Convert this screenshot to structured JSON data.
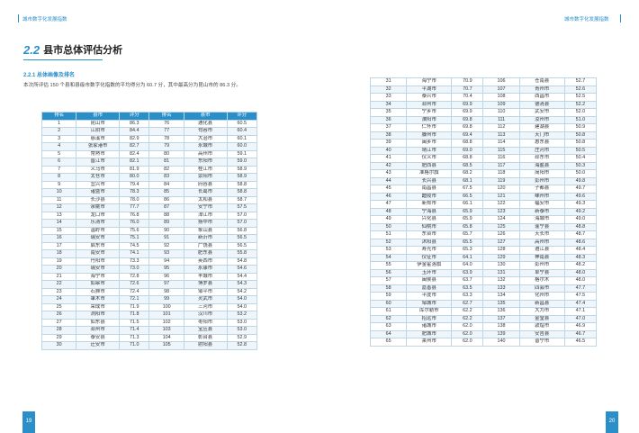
{
  "header": {
    "left_title": "城市数字化发展指数",
    "right_title": "城市数字化发展指数"
  },
  "section": {
    "number": "2.2",
    "title": "县市总体评估分析"
  },
  "subsection": {
    "title": "2.2.1 总体画像及排名"
  },
  "paragraph": "本次所评估 150 个县和县级市数字化指数的平均得分为 60.7 分，其中最高分为昆山市的 86.3 分。",
  "table_headers": [
    "排名",
    "县市",
    "评分",
    "排名",
    "县市",
    "评分"
  ],
  "left_rows": [
    [
      "1",
      "昆山市",
      "86.3",
      "76",
      "通化县",
      "60.5"
    ],
    [
      "2",
      "江阴市",
      "84.4",
      "77",
      "句容市",
      "60.4"
    ],
    [
      "3",
      "慈溪市",
      "82.9",
      "78",
      "大治市",
      "60.1"
    ],
    [
      "4",
      "张家港市",
      "82.7",
      "79",
      "永城市",
      "60.0"
    ],
    [
      "5",
      "常熟市",
      "82.4",
      "80",
      "高州市",
      "59.1"
    ],
    [
      "6",
      "晋江市",
      "82.1",
      "81",
      "东阳市",
      "59.0"
    ],
    [
      "7",
      "义乌市",
      "81.9",
      "82",
      "桂江市",
      "58.9"
    ],
    [
      "8",
      "太仓市",
      "80.0",
      "83",
      "荥阳市",
      "58.9"
    ],
    [
      "9",
      "宜兴市",
      "79.4",
      "84",
      "府谷县",
      "58.8"
    ],
    [
      "10",
      "诸暨市",
      "78.3",
      "85",
      "长葛市",
      "58.8"
    ],
    [
      "11",
      "长沙县",
      "78.0",
      "86",
      "太和县",
      "58.7"
    ],
    [
      "12",
      "余姚市",
      "77.7",
      "87",
      "安宁市",
      "57.5"
    ],
    [
      "13",
      "龙口市",
      "76.8",
      "88",
      "漳江市",
      "57.0"
    ],
    [
      "14",
      "乐清市",
      "76.0",
      "89",
      "扬中市",
      "57.0"
    ],
    [
      "15",
      "温岭市",
      "75.6",
      "90",
      "象山县",
      "56.8"
    ],
    [
      "16",
      "瑞安市",
      "75.1",
      "91",
      "新沂市",
      "56.5"
    ],
    [
      "17",
      "启东市",
      "74.5",
      "92",
      "广饶县",
      "56.5"
    ],
    [
      "18",
      "南安市",
      "74.1",
      "93",
      "肥东县",
      "55.8"
    ],
    [
      "19",
      "丹阳市",
      "73.3",
      "94",
      "英西市",
      "54.8"
    ],
    [
      "20",
      "瑞安市",
      "73.0",
      "95",
      "永康市",
      "54.6"
    ],
    [
      "21",
      "海宁市",
      "72.8",
      "96",
      "丰城市",
      "54.4"
    ],
    [
      "22",
      "如皋市",
      "72.6",
      "97",
      "博罗县",
      "54.3"
    ],
    [
      "23",
      "石狮市",
      "72.4",
      "98",
      "邹平市",
      "54.2"
    ],
    [
      "24",
      "肇木市",
      "72.1",
      "99",
      "灵武市",
      "54.0"
    ],
    [
      "25",
      "荣成市",
      "71.9",
      "100",
      "三河市",
      "54.0"
    ],
    [
      "26",
      "浏阳市",
      "71.8",
      "101",
      "汉川市",
      "53.2"
    ],
    [
      "27",
      "如东县",
      "71.5",
      "102",
      "枣阳市",
      "53.0"
    ],
    [
      "28",
      "邳州市",
      "71.4",
      "103",
      "宝应县",
      "53.0"
    ],
    [
      "29",
      "泰安县",
      "71.3",
      "104",
      "彰台县",
      "52.9"
    ],
    [
      "30",
      "迁安市",
      "71.0",
      "105",
      "射阳县",
      "52.8"
    ]
  ],
  "right_rows": [
    [
      "31",
      "海宁市",
      "70.9",
      "106",
      "苍南县",
      "52.7"
    ],
    [
      "32",
      "平湖市",
      "70.7",
      "107",
      "青州市",
      "52.6"
    ],
    [
      "33",
      "泰兴市",
      "70.4",
      "108",
      "西昌市",
      "52.5"
    ],
    [
      "34",
      "邳州市",
      "69.9",
      "109",
      "德清县",
      "52.2"
    ],
    [
      "35",
      "宁乡市",
      "69.9",
      "110",
      "武安市",
      "52.0"
    ],
    [
      "36",
      "溧阳市",
      "69.8",
      "111",
      "汝州市",
      "51.0"
    ],
    [
      "37",
      "仁怀市",
      "69.8",
      "112",
      "建湖县",
      "50.9"
    ],
    [
      "38",
      "滕州市",
      "69.4",
      "113",
      "天门市",
      "50.8"
    ],
    [
      "39",
      "闽乡市",
      "68.8",
      "114",
      "惠东县",
      "50.8"
    ],
    [
      "40",
      "靖江市",
      "69.0",
      "115",
      "庄河市",
      "50.5"
    ],
    [
      "41",
      "仪义市",
      "68.8",
      "116",
      "邳东市",
      "50.4"
    ],
    [
      "42",
      "肥西县",
      "68.5",
      "117",
      "海盐县",
      "50.3"
    ],
    [
      "43",
      "准格尔旗",
      "68.2",
      "118",
      "简阳市",
      "50.0"
    ],
    [
      "44",
      "长兴县",
      "68.1",
      "119",
      "彭州市",
      "49.8"
    ],
    [
      "45",
      "南昌县",
      "67.5",
      "120",
      "子都县",
      "49.7"
    ],
    [
      "46",
      "醴陵市",
      "66.5",
      "121",
      "嵊州市",
      "49.6"
    ],
    [
      "47",
      "新郑市",
      "66.1",
      "122",
      "福安市",
      "49.3"
    ],
    [
      "48",
      "宁海县",
      "65.9",
      "123",
      "新泰市",
      "49.2"
    ],
    [
      "49",
      "兴化县",
      "65.9",
      "124",
      "海城市",
      "49.0"
    ],
    [
      "50",
      "仙桃市",
      "65.8",
      "125",
      "蓬宁县",
      "48.8"
    ],
    [
      "51",
      "东台市",
      "65.7",
      "126",
      "天长市",
      "48.7"
    ],
    [
      "52",
      "沭阳县",
      "65.5",
      "127",
      "高州市",
      "48.6"
    ],
    [
      "53",
      "寿光市",
      "65.3",
      "128",
      "遵江县",
      "48.4"
    ],
    [
      "54",
      "仪征市",
      "64.1",
      "129",
      "神南县",
      "48.3"
    ],
    [
      "55",
      "伊金霍洛旗",
      "64.0",
      "130",
      "彭州市",
      "48.2"
    ],
    [
      "56",
      "玉环市",
      "63.9",
      "131",
      "阜宁县",
      "48.0"
    ],
    [
      "57",
      "闽侯县",
      "63.7",
      "132",
      "格尔木",
      "48.0"
    ],
    [
      "58",
      "嘉善县",
      "63.5",
      "133",
      "四会市",
      "47.7"
    ],
    [
      "59",
      "平度市",
      "63.3",
      "134",
      "化州市",
      "47.5"
    ],
    [
      "60",
      "邹城市",
      "62.7",
      "135",
      "新昌县",
      "47.4"
    ],
    [
      "61",
      "库尔勒市",
      "62.2",
      "136",
      "大为市",
      "47.1"
    ],
    [
      "62",
      "招远市",
      "62.2",
      "137",
      "金堂县",
      "47.0"
    ],
    [
      "63",
      "诸城市",
      "62.0",
      "138",
      "敦煌市",
      "46.9"
    ],
    [
      "64",
      "肥城市",
      "62.0",
      "139",
      "安吉县",
      "46.7"
    ],
    [
      "65",
      "莱州市",
      "62.0",
      "140",
      "普宁市",
      "46.5"
    ]
  ],
  "page_numbers": {
    "left": "19",
    "right": "20"
  }
}
